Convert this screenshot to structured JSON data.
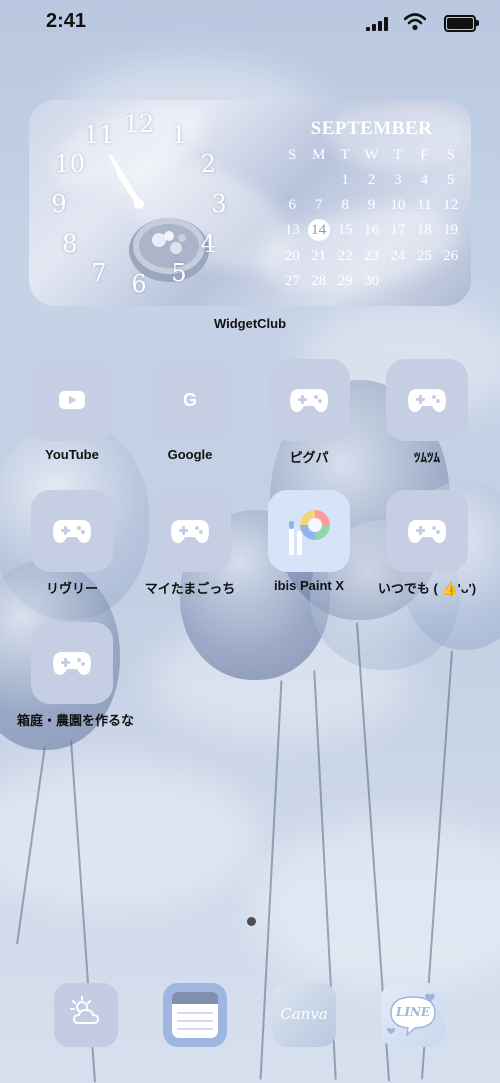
{
  "status_bar": {
    "time": "2:41"
  },
  "widget": {
    "clock_numbers": [
      "12",
      "1",
      "2",
      "3",
      "4",
      "5",
      "6",
      "7",
      "8",
      "9",
      "10",
      "11"
    ],
    "calendar": {
      "month": "SEPTEMBER",
      "weekdays": [
        "S",
        "M",
        "T",
        "W",
        "T",
        "F",
        "S"
      ],
      "days": [
        "",
        "",
        "1",
        "2",
        "3",
        "4",
        "5",
        "6",
        "7",
        "8",
        "9",
        "10",
        "11",
        "12",
        "13",
        "14",
        "15",
        "16",
        "17",
        "18",
        "19",
        "20",
        "21",
        "22",
        "23",
        "24",
        "25",
        "26",
        "27",
        "28",
        "29",
        "30"
      ],
      "today": "14"
    },
    "label": "WidgetClub"
  },
  "apps": [
    {
      "label": "YouTube",
      "icon": "youtube-icon"
    },
    {
      "label": "Google",
      "icon": "google-icon"
    },
    {
      "label": "ピグパ",
      "icon": "gamepad-icon"
    },
    {
      "label": "ﾂﾑﾂﾑ",
      "icon": "gamepad-icon"
    },
    {
      "label": "リヴリー",
      "icon": "gamepad-icon"
    },
    {
      "label": "マイたまごっち",
      "icon": "gamepad-icon"
    },
    {
      "label": "ibis Paint X",
      "icon": "palette-icon"
    },
    {
      "label": "いつでも ( 👍'ᴗ')",
      "icon": "gamepad-icon"
    },
    {
      "label": "箱庭・農園を作るな",
      "icon": "gamepad-icon"
    }
  ],
  "dock": [
    {
      "icon": "weather-cloud-sun-icon"
    },
    {
      "icon": "notes-icon"
    },
    {
      "label": "Canva",
      "icon": "canva-icon"
    },
    {
      "label": "LINE",
      "icon": "line-icon"
    }
  ],
  "colors": {
    "icon_bg": "#c5cee3",
    "dot": "#4d4d4d"
  }
}
